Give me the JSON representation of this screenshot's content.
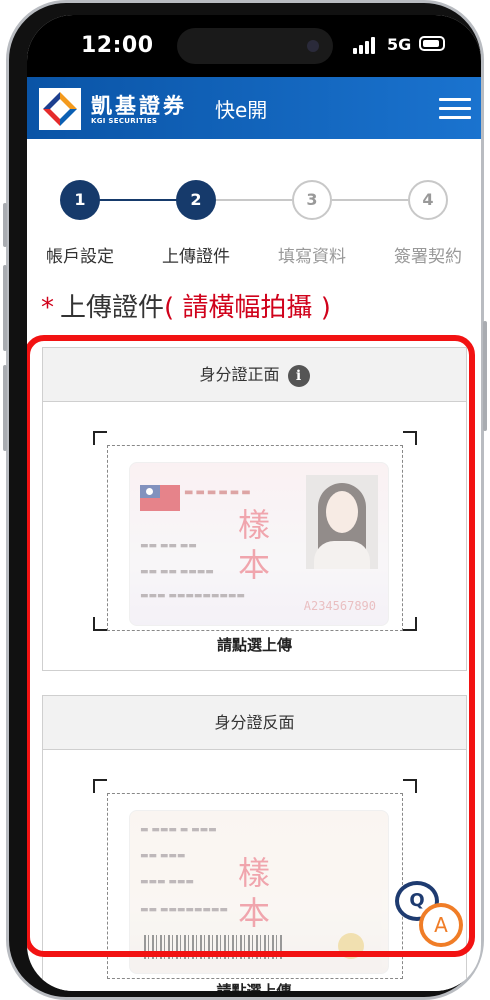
{
  "status_bar": {
    "time": "12:00",
    "network": "5G"
  },
  "header": {
    "brand_name": "凱基證券",
    "brand_sub": "KGI SECURITIES",
    "title": "快e開",
    "menu_icon": "hamburger-menu-icon",
    "gradient_colors": [
      "#0a54a6",
      "#1a73cf"
    ]
  },
  "stepper": {
    "current_step": 2,
    "steps": [
      {
        "number": "1",
        "label": "帳戶設定",
        "state": "completed"
      },
      {
        "number": "2",
        "label": "上傳證件",
        "state": "active"
      },
      {
        "number": "3",
        "label": "填寫資料",
        "state": "inactive"
      },
      {
        "number": "4",
        "label": "簽署契約",
        "state": "inactive"
      }
    ],
    "active_color": "#163a6b"
  },
  "page": {
    "required_mark": "*",
    "title": "上傳證件",
    "note": "( 請橫幅拍攝 )"
  },
  "cards": {
    "front": {
      "title": "身分證正面",
      "info_icon": "info-icon",
      "watermark": "樣本",
      "id_number": "A234567890",
      "upload_label": "請點選上傳"
    },
    "back": {
      "title": "身分證反面",
      "watermark": "樣本",
      "upload_label": "請點選上傳"
    }
  },
  "chat_widget": {
    "q_label": "Q",
    "a_label": "A",
    "icon": "qa-chat-icon"
  },
  "colors": {
    "highlight": "#f21212",
    "required": "#d0021b",
    "chat_q": "#1e3b70",
    "chat_a": "#f07d27"
  }
}
